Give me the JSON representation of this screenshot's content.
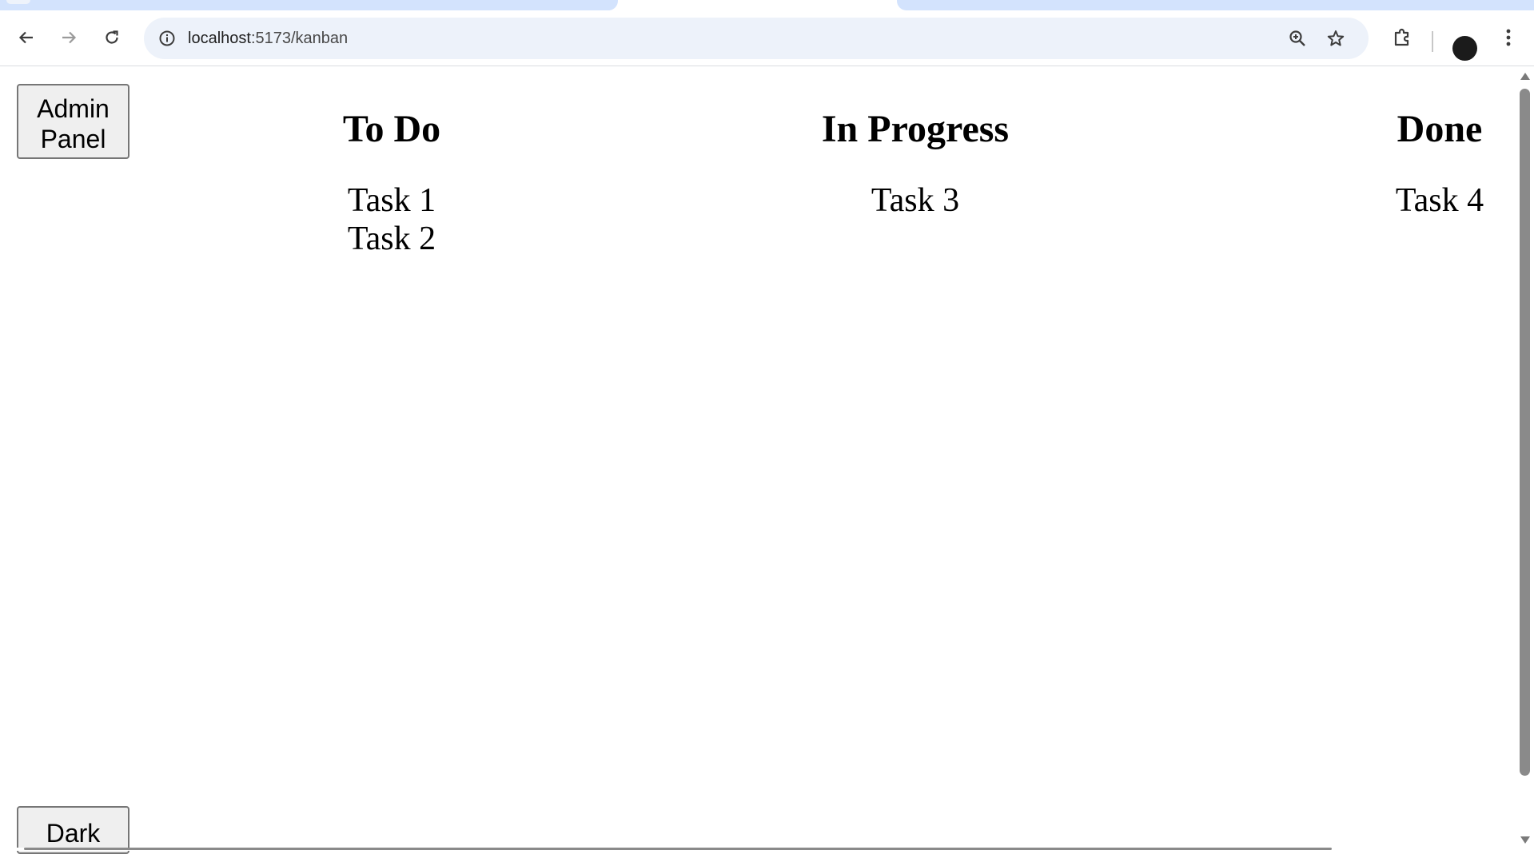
{
  "browser": {
    "url_host": "localhost",
    "url_path": ":5173/kanban"
  },
  "page": {
    "admin_button": "Admin Panel",
    "theme_button": "Dark"
  },
  "board": {
    "columns": [
      {
        "title": "To Do",
        "tasks": [
          "Task 1",
          "Task 2"
        ]
      },
      {
        "title": "In Progress",
        "tasks": [
          "Task 3"
        ]
      },
      {
        "title": "Done",
        "tasks": [
          "Task 4"
        ]
      }
    ]
  },
  "icons": {
    "back": "back-arrow-icon",
    "forward": "forward-arrow-icon",
    "reload": "reload-icon",
    "info": "info-icon",
    "zoom": "zoom-icon",
    "star": "star-icon",
    "extensions": "puzzle-icon",
    "menu": "kebab-menu-icon"
  }
}
